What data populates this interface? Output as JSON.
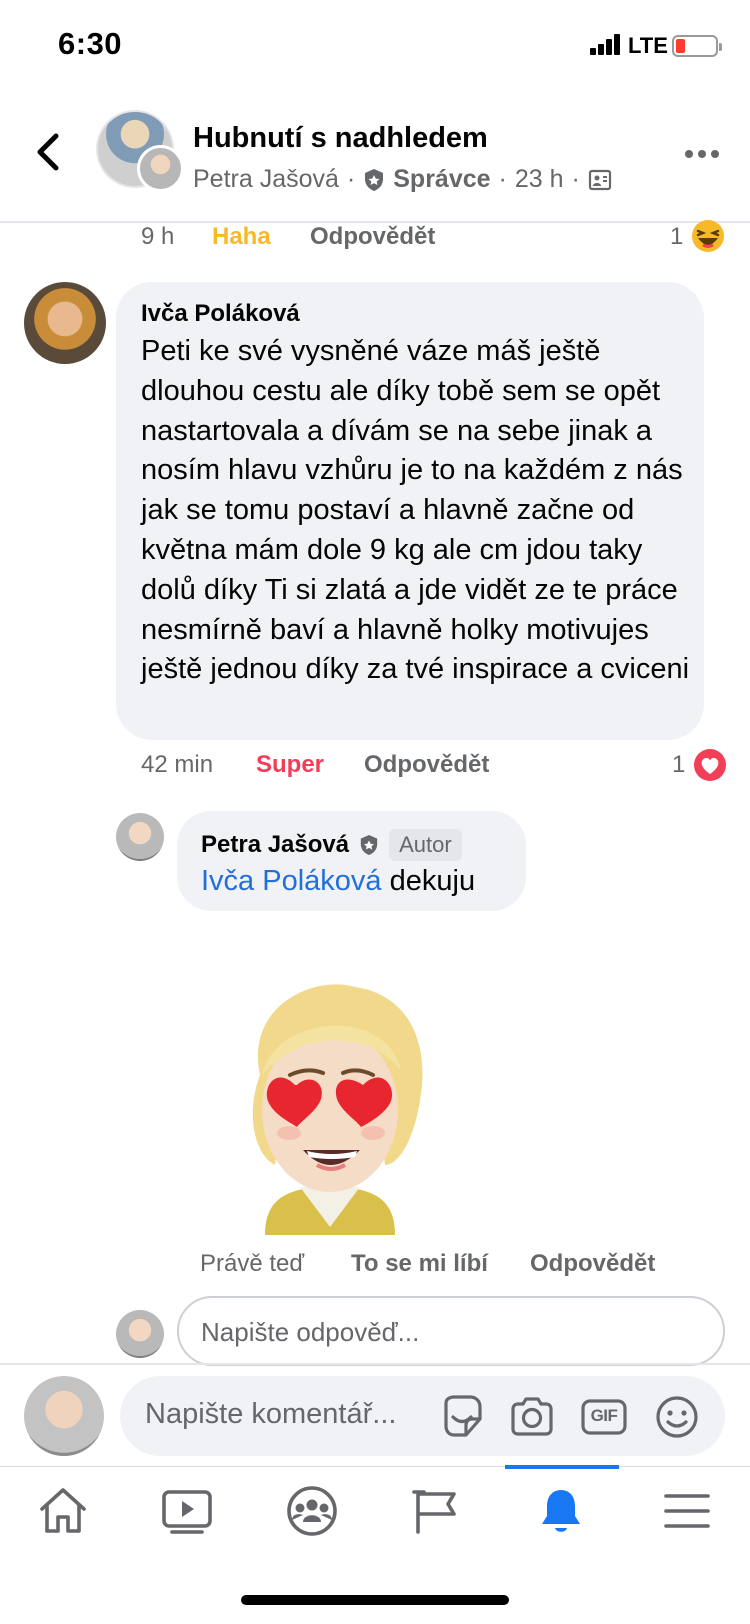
{
  "status_bar": {
    "time": "6:30",
    "network": "LTE"
  },
  "header": {
    "group_title": "Hubnutí s nadhledem",
    "author": "Petra Jašová",
    "separator": "·",
    "role": "Správce",
    "time": "23 h"
  },
  "prev_comment_actions": {
    "time": "9 h",
    "reaction": "Haha",
    "reply": "Odpovědět",
    "reaction_count": "1"
  },
  "comment": {
    "author": "Ivča Poláková",
    "text": "Peti ke své vysněné váze máš ještě dlouhou cestu ale díky tobě sem se opět nastartovala a dívám se na sebe jinak a nosím hlavu vzhůru je to na každém z nás jak se  tomu postaví a hlavně začne od května mám dole 9 kg ale cm jdou taky dolů díky Ti si zlatá a jde vidět ze te práce nesmírně baví a hlavně holky motivujes ještě jednou díky za tvé inspirace a cviceni",
    "time": "42 min",
    "reaction": "Super",
    "reply": "Odpovědět",
    "reaction_count": "1"
  },
  "reply": {
    "author": "Petra Jašová",
    "badge": "Autor",
    "mention": "Ivča Poláková",
    "text": "dekuju",
    "time": "Právě teď",
    "like": "To se mi líbí",
    "reply": "Odpovědět"
  },
  "reply_input": {
    "placeholder": "Napište odpověď..."
  },
  "composer": {
    "placeholder": "Napište komentář...",
    "gif_label": "GIF"
  },
  "colors": {
    "accent": "#1877f2",
    "haha": "#f7b928",
    "love": "#f33e58",
    "bubble": "#f0f2f5",
    "secondary_text": "#65676b"
  },
  "nav": {
    "items": [
      "home-icon",
      "watch-icon",
      "groups-icon",
      "pages-icon",
      "notifications-icon",
      "menu-icon"
    ],
    "active": "notifications-icon"
  }
}
